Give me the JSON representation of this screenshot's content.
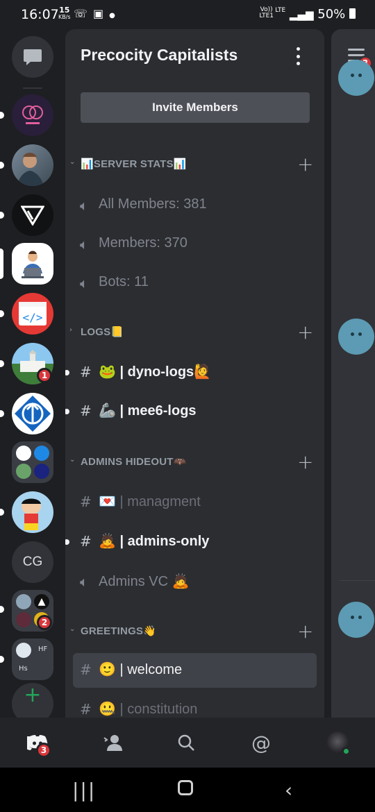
{
  "status_bar": {
    "time": "16:07",
    "speed_value": "15",
    "speed_unit": "KB/s",
    "volte": "Vo))",
    "lte_top": "LTE",
    "lte_bottom": "LTE1",
    "battery": "50%"
  },
  "server_rail": {
    "dm_icon": "chat-bubble-icon",
    "servers": [
      {
        "name": "server-1",
        "unread": true
      },
      {
        "name": "server-2",
        "unread": true
      },
      {
        "name": "server-3",
        "unread": true
      },
      {
        "name": "server-4",
        "active": true
      },
      {
        "name": "server-5",
        "unread": true
      },
      {
        "name": "server-6",
        "unread": true,
        "badge": "1"
      },
      {
        "name": "server-7",
        "unread": true
      },
      {
        "name": "server-8-folder"
      },
      {
        "name": "server-9",
        "unread": true
      },
      {
        "name": "server-10",
        "initials": "CG"
      },
      {
        "name": "server-11-folder",
        "unread": true,
        "badge": "2"
      },
      {
        "name": "server-12-folder",
        "unread": true,
        "text_a": "HF",
        "text_b": "Hs"
      }
    ],
    "add_server_icon": "plus-icon"
  },
  "server": {
    "name": "Precocity Capitalists",
    "invite_label": "Invite Members"
  },
  "categories": {
    "server_stats": "SERVER STATS",
    "logs": "LOGS",
    "admins_hideout": "ADMINS HIDEOUT",
    "greetings": "GREETINGS"
  },
  "channels": {
    "all_members": "All Members: 381",
    "members": "Members: 370",
    "bots": "Bots: 11",
    "dyno_logs": "| dyno-logs",
    "mee6_logs": "| mee6-logs",
    "managment": "| managment",
    "admins_only": "| admins-only",
    "admins_vc": "Admins VC",
    "welcome": "| welcome",
    "constitution": "| constitution"
  },
  "chat_peek": {
    "mentions_badge": "3"
  },
  "bottom_nav": {
    "home_badge": "3"
  },
  "colors": {
    "background": "#1e1f22",
    "panel": "#2b2d31",
    "selected": "#404249",
    "badge": "#da373c",
    "add_server": "#23a559"
  }
}
